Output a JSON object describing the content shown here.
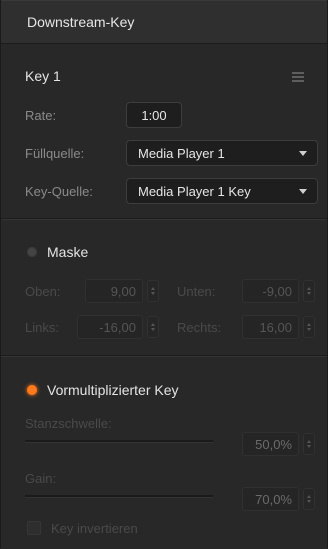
{
  "header": {
    "title": "Downstream-Key"
  },
  "key_section": {
    "title": "Key 1",
    "rate_label": "Rate:",
    "rate_value": "1:00",
    "fill_label": "Füllquelle:",
    "fill_value": "Media Player 1",
    "key_source_label": "Key-Quelle:",
    "key_source_value": "Media Player 1 Key"
  },
  "mask_section": {
    "title": "Maske",
    "enabled": false,
    "top_label": "Oben:",
    "top_value": "9,00",
    "bottom_label": "Unten:",
    "bottom_value": "-9,00",
    "left_label": "Links:",
    "left_value": "-16,00",
    "right_label": "Rechts:",
    "right_value": "16,00"
  },
  "premult_section": {
    "title": "Vormultiplizierter Key",
    "enabled": true,
    "clip_label": "Stanzschwelle:",
    "clip_value": "50,0%",
    "gain_label": "Gain:",
    "gain_value": "70,0%",
    "invert_label": "Key invertieren",
    "invert_checked": false
  },
  "colors": {
    "accent_active": "#ff7a1a",
    "panel_bg": "#282828",
    "field_bg": "#1e1e1e"
  }
}
